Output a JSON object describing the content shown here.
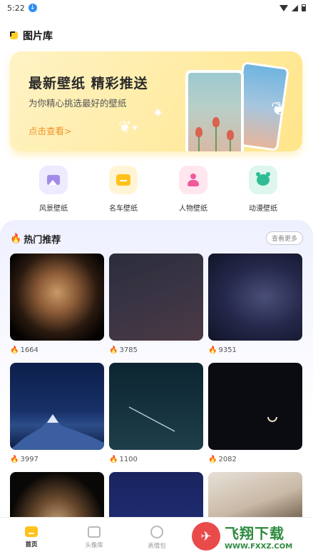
{
  "status_bar": {
    "time": "5:22"
  },
  "header": {
    "title": "图片库"
  },
  "banner": {
    "title": "最新壁纸 精彩推送",
    "subtitle": "为你精心挑选最好的壁纸",
    "cta": "点击查看>"
  },
  "categories": [
    {
      "label": "风景壁纸",
      "icon": "landscape-icon",
      "bg": "#eeeaff"
    },
    {
      "label": "名车壁纸",
      "icon": "car-icon",
      "bg": "#fff5d6"
    },
    {
      "label": "人物壁纸",
      "icon": "person-icon",
      "bg": "#ffe6ef"
    },
    {
      "label": "动漫壁纸",
      "icon": "bear-icon",
      "bg": "#ddf6ee"
    }
  ],
  "hot": {
    "title": "热门推荐",
    "more_label": "查看更多",
    "items": [
      {
        "count": "1664"
      },
      {
        "count": "3785"
      },
      {
        "count": "9351"
      },
      {
        "count": "3997"
      },
      {
        "count": "1100"
      },
      {
        "count": "2082"
      },
      {
        "count": ""
      },
      {
        "count": ""
      },
      {
        "count": ""
      }
    ]
  },
  "bottom_nav": [
    {
      "label": "首页",
      "icon": "home-icon",
      "active": true
    },
    {
      "label": "头像库",
      "icon": "avatar-icon",
      "active": false
    },
    {
      "label": "表情包",
      "icon": "emoji-icon",
      "active": false
    }
  ],
  "watermark": {
    "main": "飞翔下载",
    "sub": "WWW.FXXZ.COM"
  },
  "colors": {
    "accent": "#ffc21a",
    "flame": "#ff6a2b",
    "cta": "#f0922a"
  }
}
